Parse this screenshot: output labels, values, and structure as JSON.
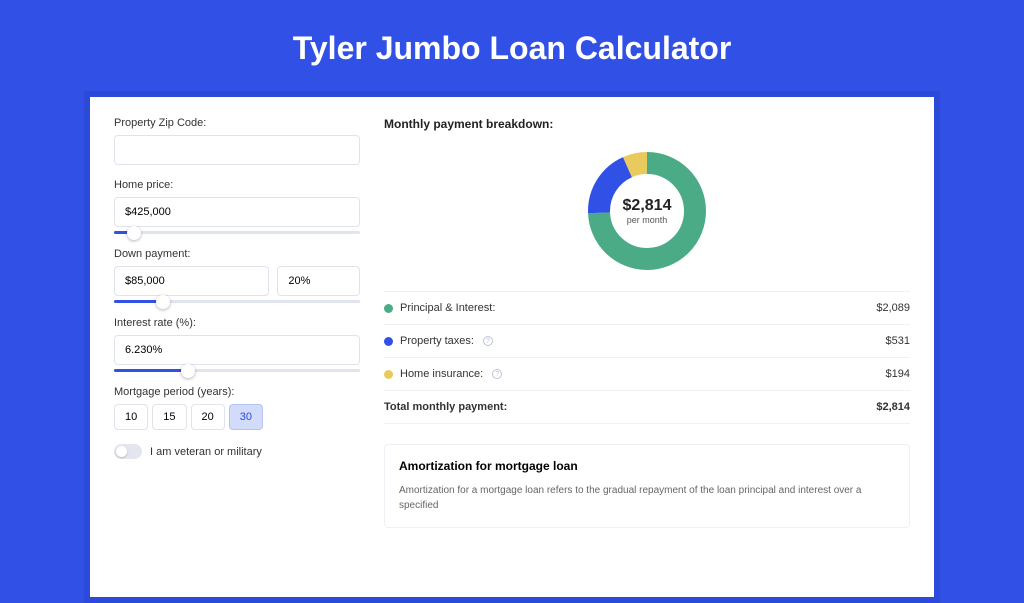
{
  "title": "Tyler Jumbo Loan Calculator",
  "form": {
    "zip": {
      "label": "Property Zip Code:",
      "value": ""
    },
    "home_price": {
      "label": "Home price:",
      "value": "$425,000",
      "slider_pos": 8
    },
    "down_payment": {
      "label": "Down payment:",
      "amount": "$85,000",
      "percent": "20%",
      "slider_pos": 20
    },
    "interest_rate": {
      "label": "Interest rate (%):",
      "value": "6.230%",
      "slider_pos": 30
    },
    "mortgage_period": {
      "label": "Mortgage period (years):",
      "options": [
        "10",
        "15",
        "20",
        "30"
      ],
      "selected": "30"
    },
    "veteran": {
      "label": "I am veteran or military"
    }
  },
  "breakdown": {
    "title": "Monthly payment breakdown:",
    "donut": {
      "value": "$2,814",
      "caption": "per month"
    },
    "items": [
      {
        "color": "#4bab86",
        "label": "Principal & Interest:",
        "value": "$2,089",
        "info": false
      },
      {
        "color": "#3151e6",
        "label": "Property taxes:",
        "value": "$531",
        "info": true
      },
      {
        "color": "#e8ca5e",
        "label": "Home insurance:",
        "value": "$194",
        "info": true
      }
    ],
    "total": {
      "label": "Total monthly payment:",
      "value": "$2,814"
    }
  },
  "amortization": {
    "title": "Amortization for mortgage loan",
    "text": "Amortization for a mortgage loan refers to the gradual repayment of the loan principal and interest over a specified"
  },
  "chart_data": {
    "type": "pie",
    "title": "Monthly payment breakdown",
    "series": [
      {
        "name": "Principal & Interest",
        "value": 2089,
        "color": "#4bab86"
      },
      {
        "name": "Property taxes",
        "value": 531,
        "color": "#3151e6"
      },
      {
        "name": "Home insurance",
        "value": 194,
        "color": "#e8ca5e"
      }
    ],
    "total": 2814
  }
}
